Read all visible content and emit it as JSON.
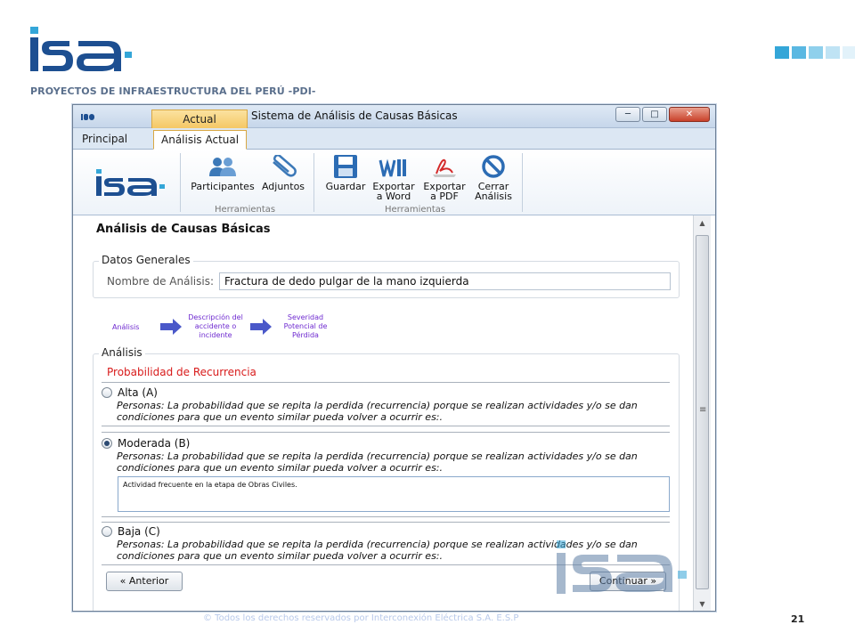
{
  "header": {
    "company_line": "PROYECTOS DE INFRAESTRUCTURA DEL PERÚ -PDI-",
    "brand_color": "#1d4f91",
    "accent_color": "#34a6d8"
  },
  "window": {
    "context_tab": "Actual",
    "title": "Sistema de Análisis de Causas Básicas",
    "controls": {
      "minimize": "─",
      "maximize": "□",
      "close": "✕"
    }
  },
  "tabs": [
    {
      "label": "Principal",
      "active": false
    },
    {
      "label": "Análisis Actual",
      "active": true
    }
  ],
  "ribbon": {
    "participantes": "Participantes",
    "adjuntos": "Adjuntos",
    "guardar": "Guardar",
    "exportar_word_1": "Exportar",
    "exportar_word_2": "a Word",
    "exportar_pdf_1": "Exportar",
    "exportar_pdf_2": "a PDF",
    "cerrar_1": "Cerrar",
    "cerrar_2": "Análisis",
    "group1_label": "Herramientas",
    "group2_label": "Herramientas"
  },
  "main": {
    "section_title": "Análisis de Causas Básicas",
    "datos_generales": {
      "legend": "Datos Generales",
      "nombre_label": "Nombre de Análisis:",
      "nombre_value": "Fractura de dedo pulgar de la mano izquierda"
    },
    "flow": {
      "step1": "Análisis",
      "step2_1": "Descripción del",
      "step2_2": "accidente o",
      "step2_3": "incidente",
      "step3_1": "Severidad",
      "step3_2": "Potencial de",
      "step3_3": "Pérdida"
    },
    "analisis": {
      "legend": "Análisis",
      "prob_title": "Probabilidad de Recurrencia",
      "options": [
        {
          "label": "Alta (A)",
          "selected": false,
          "line1": "Personas: La probabilidad que  se repita la perdida (recurrencia) porque se realizan actividades y/o se dan",
          "line2": "condiciones para que un evento similar pueda volver a ocurrir es:."
        },
        {
          "label": "Moderada (B)",
          "selected": true,
          "line1": "Personas: La probabilidad que  se repita la perdida (recurrencia) porque se realizan actividades y/o se dan",
          "line2": "condiciones para que un evento similar pueda volver a ocurrir es:."
        },
        {
          "label": "Baja (C)",
          "selected": false,
          "line1": "Personas: La probabilidad que  se repita la perdida (recurrencia) porque se realizan actividades y/o se dan",
          "line2": "condiciones para que un evento similar pueda volver a ocurrir es:."
        }
      ],
      "moderada_comment": "Actividad frecuente en la etapa de Obras Civiles."
    },
    "buttons": {
      "anterior": "« Anterior",
      "continuar": "Continuar »"
    }
  },
  "footer": {
    "copyright": "© Todos los derechos reservados por Interconexión Eléctrica S.A. E.S.P",
    "page_number": "21"
  }
}
